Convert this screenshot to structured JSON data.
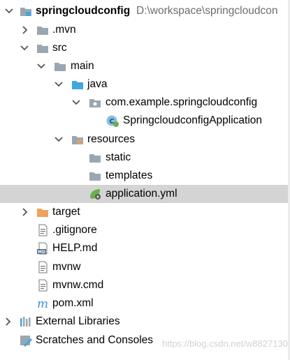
{
  "tree": {
    "root": {
      "label": "springcloudconfig",
      "path": "D:\\workspace\\springcloudcon"
    },
    "mvn": {
      "label": ".mvn"
    },
    "src": {
      "label": "src"
    },
    "main": {
      "label": "main"
    },
    "java": {
      "label": "java"
    },
    "package": {
      "label": "com.example.springcloudconfig"
    },
    "app_class": {
      "label": "SpringcloudconfigApplication"
    },
    "resources": {
      "label": "resources"
    },
    "static": {
      "label": "static"
    },
    "templates": {
      "label": "templates"
    },
    "application_yml": {
      "label": "application.yml",
      "selected": true
    },
    "target": {
      "label": "target"
    },
    "gitignore": {
      "label": ".gitignore"
    },
    "help_md": {
      "label": "HELP.md"
    },
    "mvnw": {
      "label": "mvnw"
    },
    "mvnw_cmd": {
      "label": "mvnw.cmd"
    },
    "pom": {
      "label": "pom.xml"
    },
    "external_libraries": {
      "label": "External Libraries"
    },
    "scratches": {
      "label": "Scratches and Consoles"
    }
  },
  "watermark": "https://blog.csdn.net/w8827130",
  "colors": {
    "folder": "#9aa7b0",
    "source_folder": "#40a6e0",
    "excluded_folder": "#f0a35a",
    "selection": "#d4d4d4",
    "spring_green": "#6ab04c",
    "maven_blue": "#3d8fd6"
  }
}
